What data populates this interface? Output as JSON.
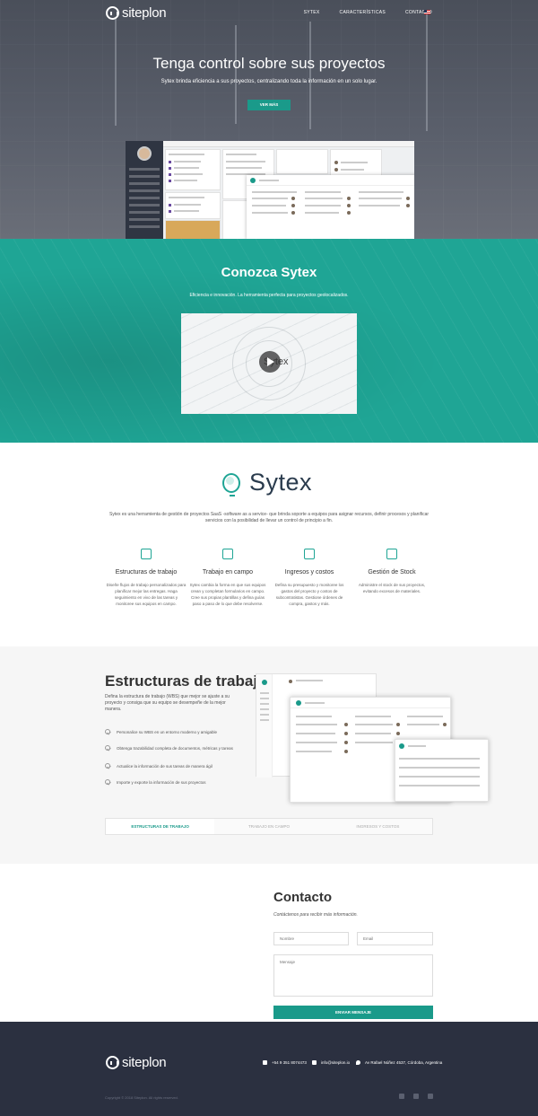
{
  "brand": {
    "logo_text": "siteplon"
  },
  "nav": {
    "links": [
      "Sytex",
      "Características",
      "Contacto"
    ]
  },
  "hero": {
    "title": "Tenga control sobre sus proyectos",
    "subtitle": "Sytex brinda eficiencia a sus proyectos, centralizando toda la información en un solo lugar.",
    "button": "Ver más"
  },
  "conozca": {
    "title": "Conozca Sytex",
    "subtitle": "Eficiencia e innovación. La herramienta perfecta para proyectos geolocalizados.",
    "video_logo": "Sytex"
  },
  "about": {
    "brand": "Sytex",
    "description": "Sytex es una herramienta de gestión de proyectos SaaS -software as a service- que brinda soporte a equipos para asignar recursos, definir procesos y planificar servicios con la posibilidad de llevar un control de principio a fin.",
    "features": [
      {
        "icon": "edit-icon",
        "title": "Estructuras de trabajo",
        "text": "Diseñe flujos de trabajo personalizados para planificar mejor las entregas. Haga seguimiento en vivo de las tareas y monitoree sus equipos en campo."
      },
      {
        "icon": "camera-icon",
        "title": "Trabajo en campo",
        "text": "Sytex cambia la forma en que sus equipos crean y completan formularios en campo. Cree sus propias plantillas y defina guías paso a paso de lo que debe resolverse."
      },
      {
        "icon": "money-icon",
        "title": "Ingresos y costos",
        "text": "Defina su presupuesto y monitoree los gastos del proyecto y costos de subcontratistas. Gestione órdenes de compra, gastos y más."
      },
      {
        "icon": "cart-icon",
        "title": "Gestión de Stock",
        "text": "Administre el stock de sus proyectos, evitando excesos de materiales."
      }
    ]
  },
  "estructuras": {
    "title": "Estructuras de trabajo",
    "description": "Defina la estructura de trabajo (WBS) que mejor se ajuste a su proyecto y consiga que su equipo se desempeñe de la mejor manera.",
    "bullets": [
      "Personalice su WBS en un entorno moderno y amigable",
      "Obtenga trazabilidad completa de documentos, métricas y tareas",
      "Actualice la información de sus tareas de manera ágil",
      "Importe y exporte la información de sus proyectos"
    ],
    "tabs": [
      "Estructuras de trabajo",
      "Trabajo en campo",
      "Ingresos y costos"
    ]
  },
  "contacto": {
    "title": "Contacto",
    "subtitle": "Contáctenos para recibir más información.",
    "name_placeholder": "Nombre",
    "email_placeholder": "Email",
    "message_placeholder": "Mensaje",
    "button": "Enviar mensaje"
  },
  "footer": {
    "logo_text": "siteplon",
    "phone": "+54 9 351 8074473",
    "email": "info@siteplon.io",
    "address": "Av Rafael Núñez 4537, Córdoba, Argentina",
    "copyright": "Copyright © 2018 Siteplon. All rights reserved."
  },
  "colors": {
    "teal": "#1fa595",
    "dark": "#2b3040"
  }
}
